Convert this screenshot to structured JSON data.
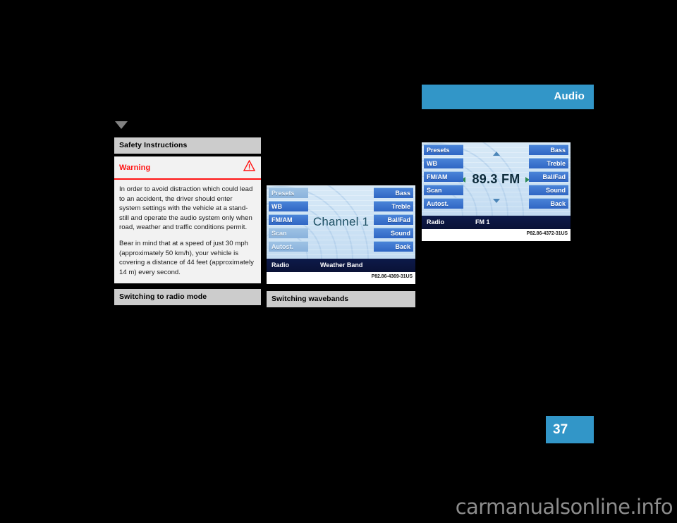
{
  "chapter": {
    "title": "Audio",
    "accent_color": "#3296c8"
  },
  "page_number": "37",
  "watermark": "carmanualsonline.info",
  "left_column": {
    "marker_icon": "triangle-down-icon",
    "section_heading": "Safety Instructions",
    "warning": {
      "title": "Warning",
      "icon": "warning-triangle-icon",
      "title_color": "#ff1414",
      "paragraphs": [
        "In order to avoid distraction which could lead to an accident, the driver should enter system settings with the vehicle at a stand-still and operate the audio system only when road, weather and traffic conditions permit.",
        "Bear in mind that at a speed of just 30 mph (approximately 50 km/h), your vehicle is covering a distance of 44 feet (approximately 14 m) every second."
      ]
    },
    "next_heading": "Switching to radio mode"
  },
  "middle_figure": {
    "screen": {
      "left_buttons": [
        {
          "label": "Presets",
          "active": false
        },
        {
          "label": "WB",
          "active": true
        },
        {
          "label": "FM/AM",
          "active": true
        },
        {
          "label": "Scan",
          "active": false
        },
        {
          "label": "Autost.",
          "active": false
        }
      ],
      "right_buttons": [
        {
          "label": "Bass",
          "active": true
        },
        {
          "label": "Treble",
          "active": true
        },
        {
          "label": "Bal/Fad",
          "active": true
        },
        {
          "label": "Sound",
          "active": true
        },
        {
          "label": "Back",
          "active": true
        }
      ],
      "center_text": "Channel 1",
      "show_tuning_arrows": false,
      "status_left": "Radio",
      "status_mid": "Weather Band"
    },
    "reference": "P82.86-4369-31US",
    "heading": "Switching wavebands"
  },
  "right_figure": {
    "screen": {
      "left_buttons": [
        {
          "label": "Presets",
          "active": true
        },
        {
          "label": "WB",
          "active": true
        },
        {
          "label": "FM/AM",
          "active": true
        },
        {
          "label": "Scan",
          "active": true
        },
        {
          "label": "Autost.",
          "active": true
        }
      ],
      "right_buttons": [
        {
          "label": "Bass",
          "active": true
        },
        {
          "label": "Treble",
          "active": true
        },
        {
          "label": "Bal/Fad",
          "active": true
        },
        {
          "label": "Sound",
          "active": true
        },
        {
          "label": "Back",
          "active": true
        }
      ],
      "center_text": "89.3 FM",
      "show_tuning_arrows": true,
      "minus_label": "-",
      "plus_label": "+",
      "status_left": "Radio",
      "status_mid": "FM 1"
    },
    "reference": "P82.86-4372-31US"
  }
}
